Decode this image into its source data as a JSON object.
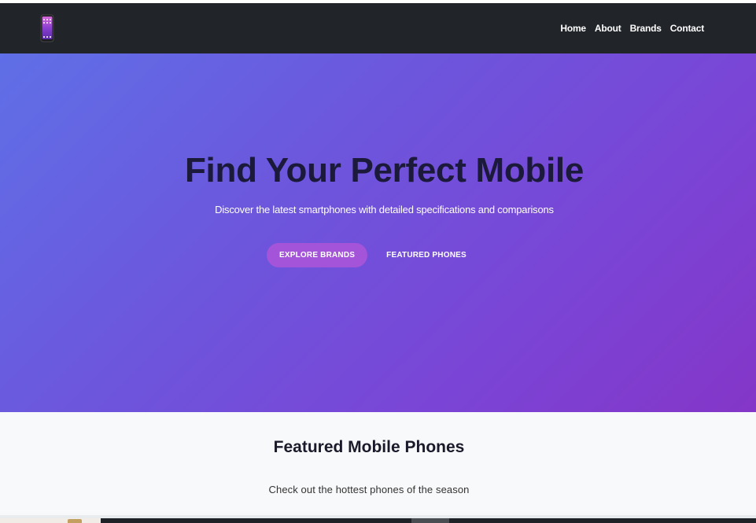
{
  "nav": {
    "logo_icon": "phone-logo-icon",
    "links": [
      "Home",
      "About",
      "Brands",
      "Contact"
    ]
  },
  "hero": {
    "title": "Find Your Perfect Mobile",
    "subtitle": "Discover the latest smartphones with detailed specifications and comparisons",
    "primary_button": "EXPLORE BRANDS",
    "secondary_button": "FEATURED PHONES"
  },
  "featured": {
    "title": "Featured Mobile Phones",
    "subtitle": "Check out the hottest phones of the season"
  },
  "colors": {
    "navbar": "#212529",
    "hero_gradient_start": "#5f6fe6",
    "hero_gradient_end": "#8436c8",
    "accent_button": "#a354d8",
    "section_background": "#f8f9fa"
  }
}
